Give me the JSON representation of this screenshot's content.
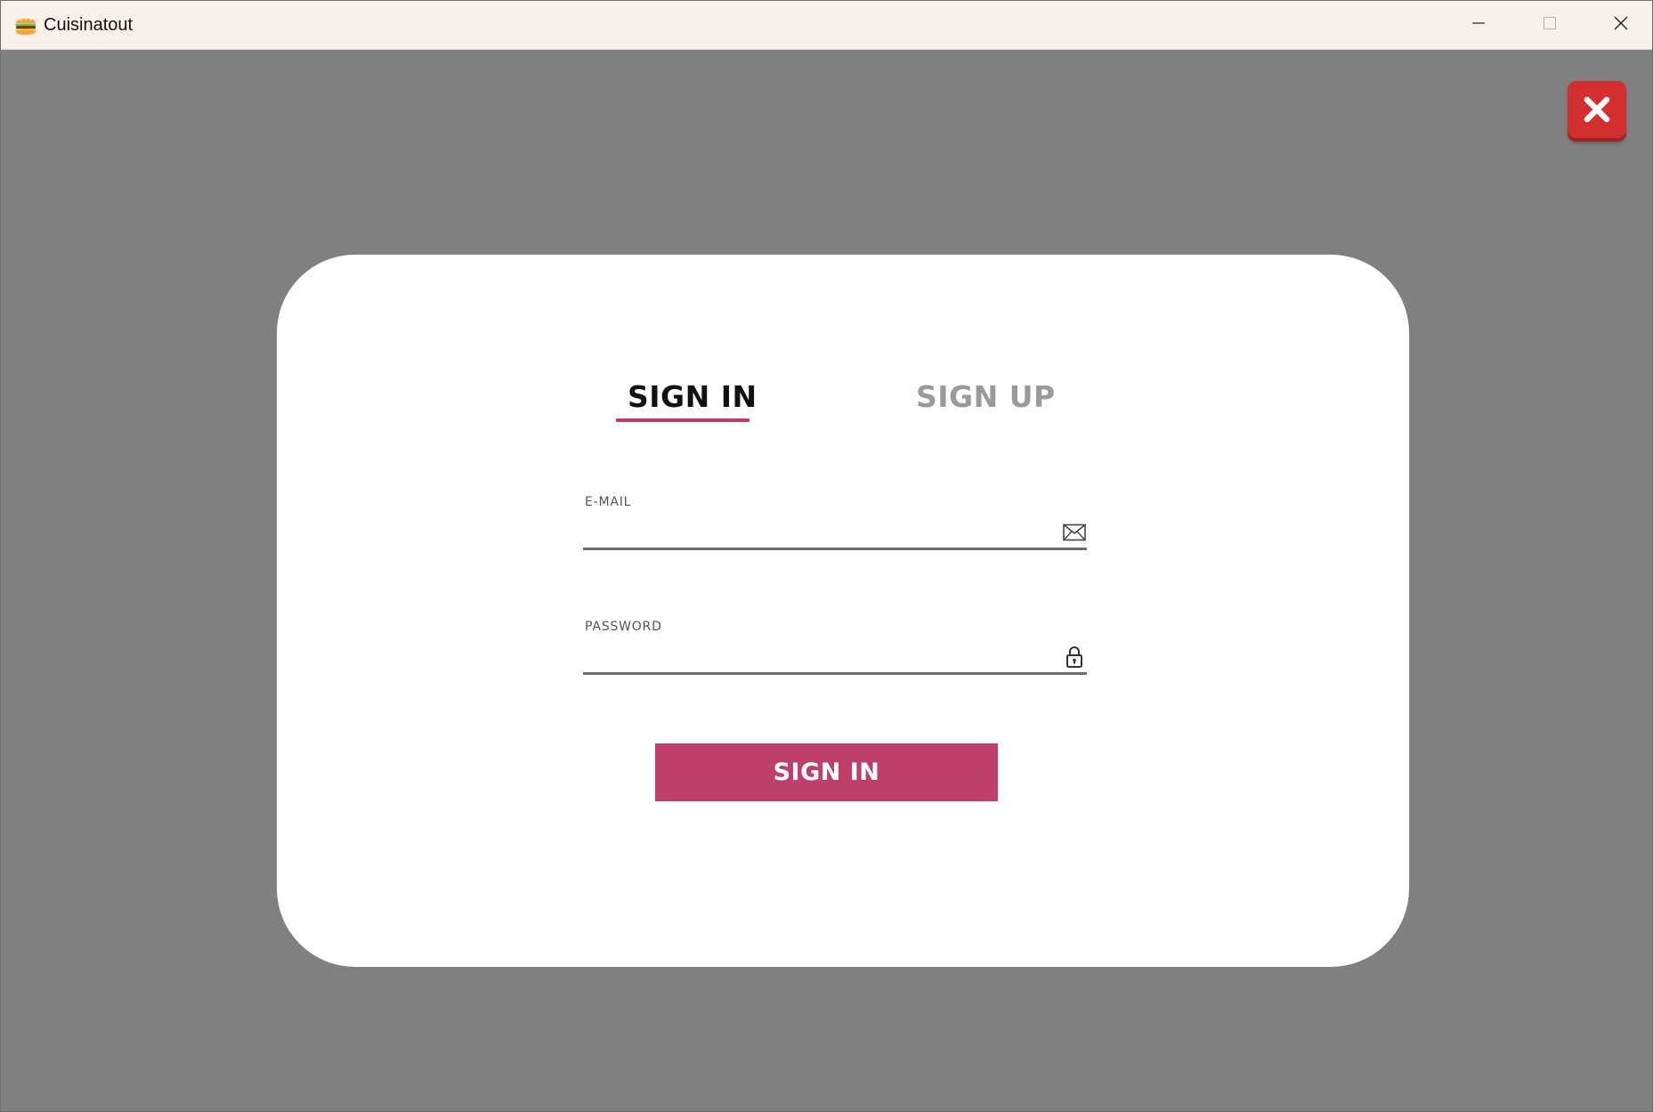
{
  "window": {
    "title": "Cuisinatout",
    "app_icon": "burger-icon",
    "controls": {
      "minimize_icon": "minimize-icon",
      "maximize_icon": "maximize-icon",
      "close_icon": "close-icon"
    }
  },
  "overlay": {
    "close_icon": "close-x-icon",
    "close_color": "#d32f2f",
    "background_color": "#808080"
  },
  "auth": {
    "tabs": [
      {
        "label": "SIGN IN",
        "active": true
      },
      {
        "label": "SIGN UP",
        "active": false
      }
    ],
    "fields": {
      "email": {
        "label": "E-MAIL",
        "value": "",
        "icon": "envelope-icon"
      },
      "password": {
        "label": "PASSWORD",
        "value": "",
        "icon": "lock-icon"
      }
    },
    "submit_label": "SIGN IN",
    "accent_color": "#be4068"
  }
}
